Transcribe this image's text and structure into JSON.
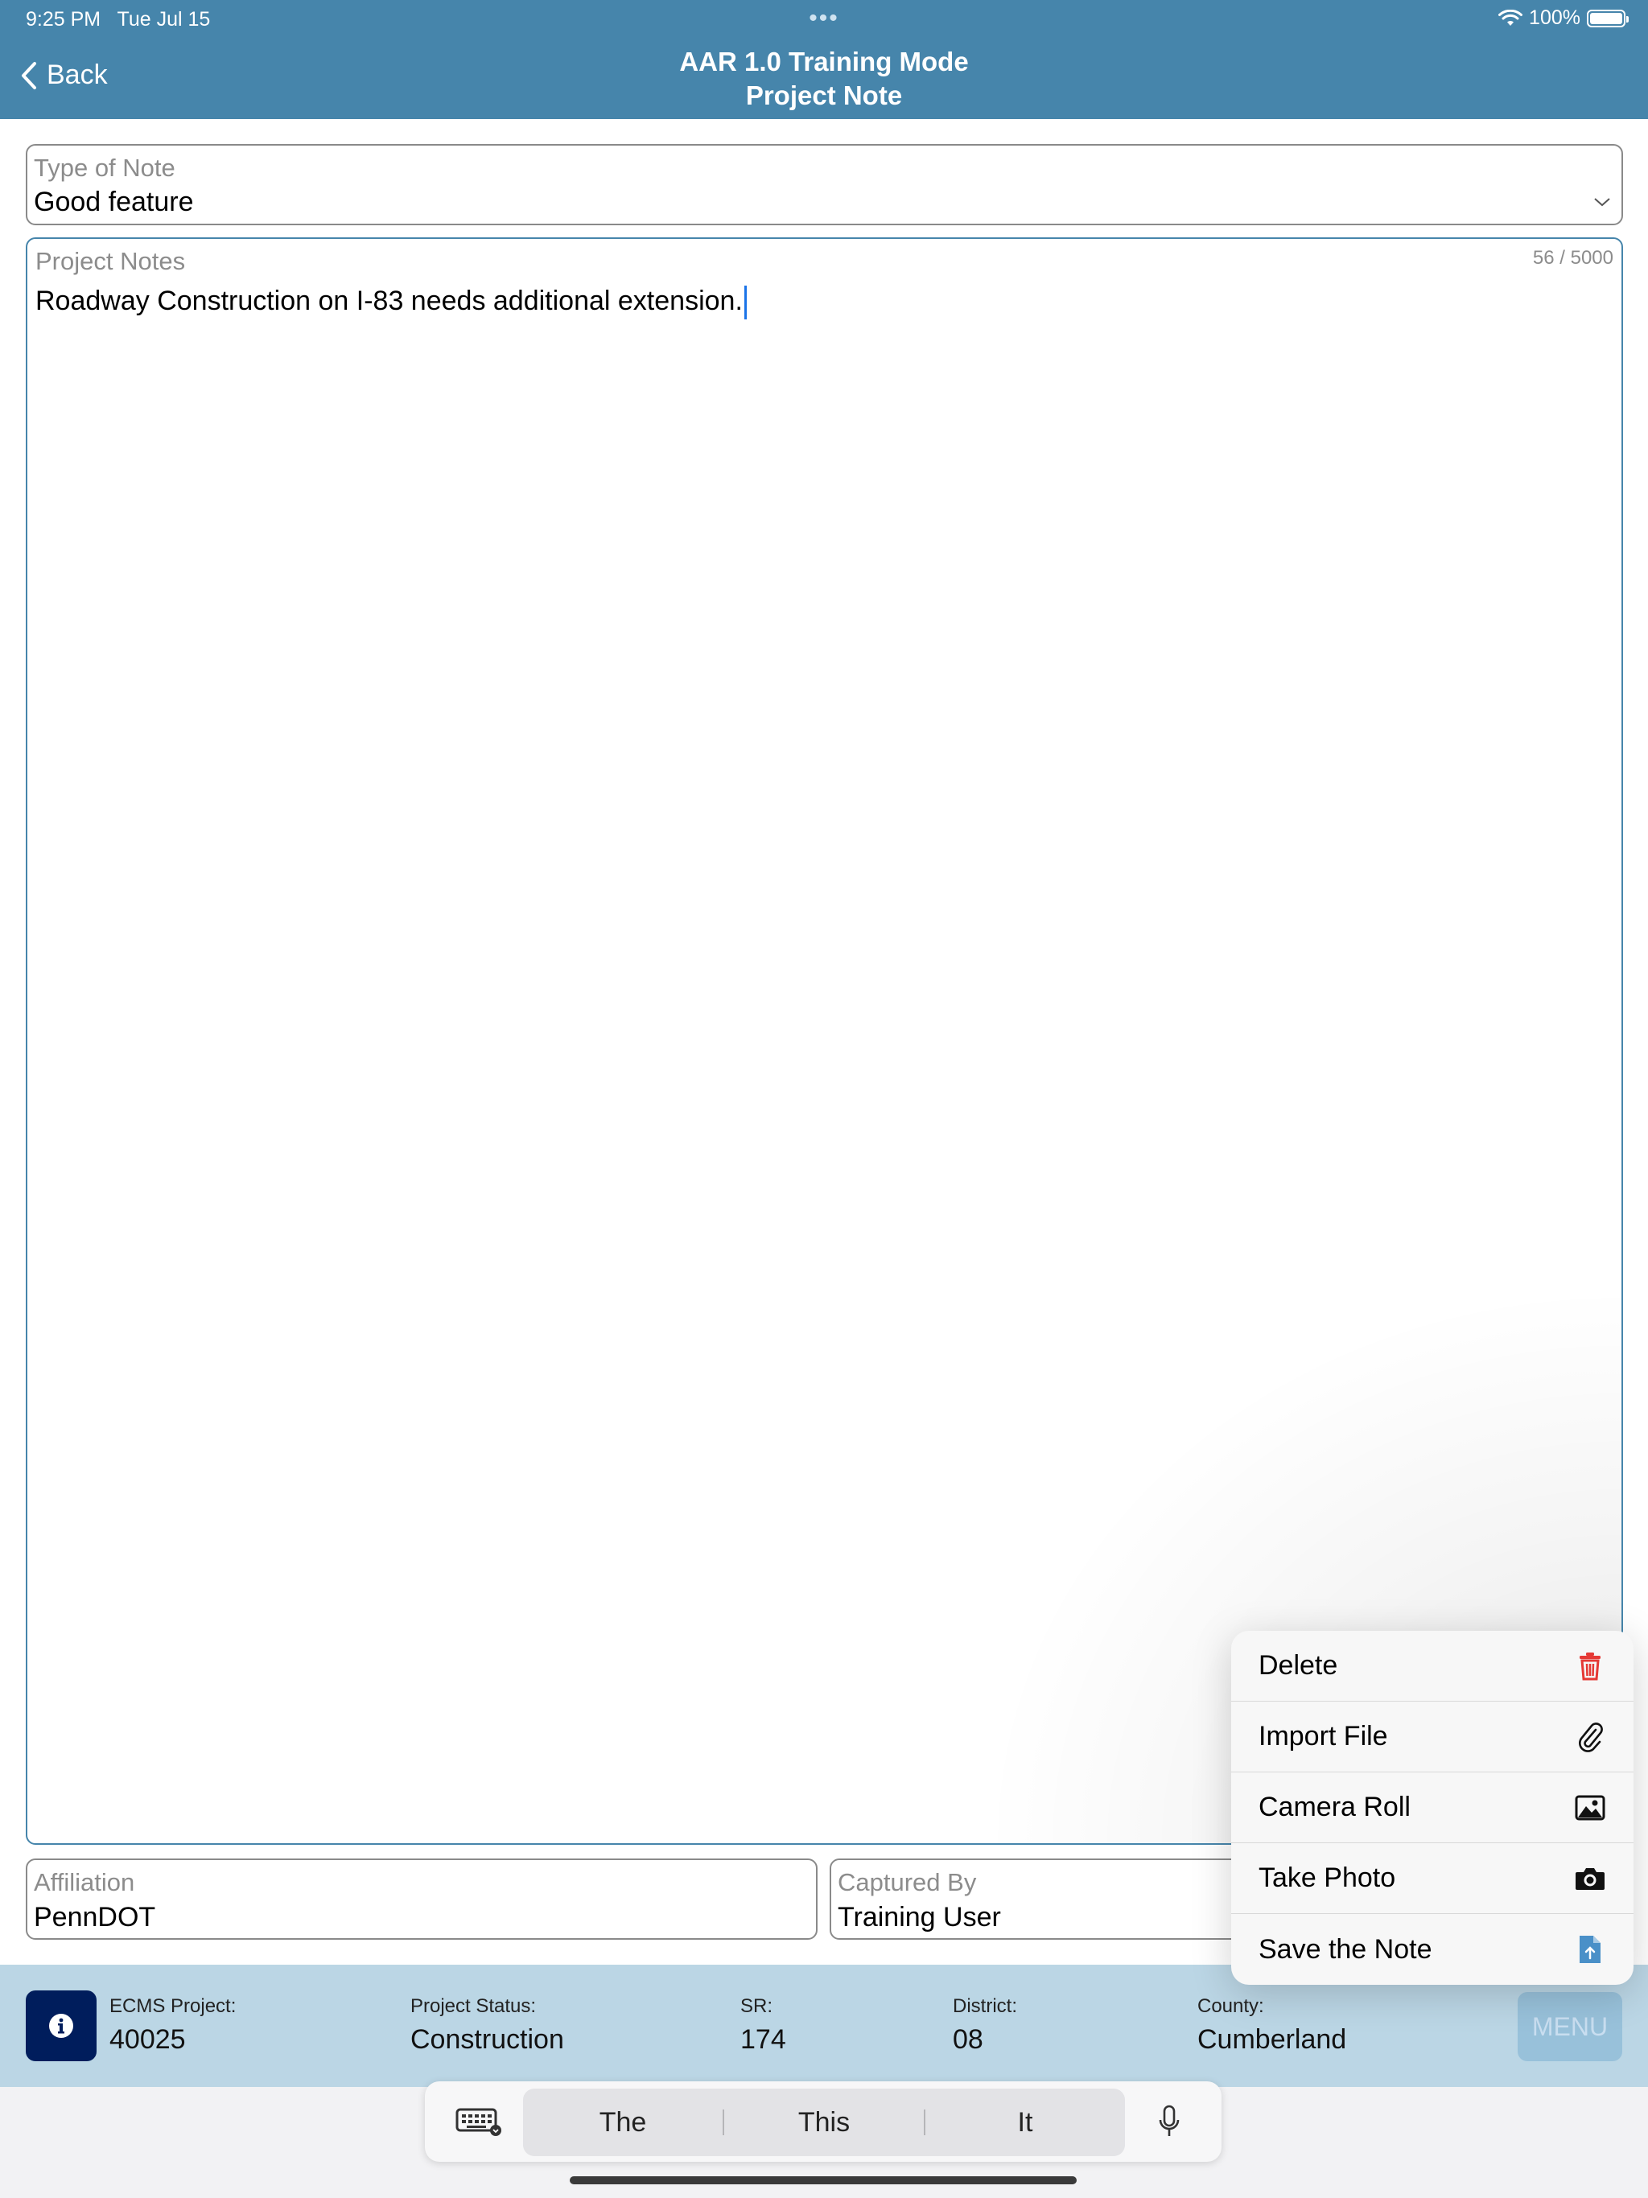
{
  "status_bar": {
    "time": "9:25 PM",
    "date": "Tue Jul 15",
    "battery": "100%"
  },
  "header": {
    "back_label": "Back",
    "title_line1": "AAR 1.0 Training Mode",
    "title_line2": "Project Note",
    "color": "#4685ab"
  },
  "form": {
    "type_of_note": {
      "label": "Type of Note",
      "value": "Good feature"
    },
    "project_notes": {
      "label": "Project Notes",
      "counter": "56 / 5000",
      "value": "Roadway Construction on I-83 needs additional extension."
    },
    "affiliation": {
      "label": "Affiliation",
      "value": "PennDOT"
    },
    "captured_by": {
      "label": "Captured By",
      "value": "Training User"
    }
  },
  "popup_menu": {
    "items": [
      {
        "label": "Delete",
        "icon": "trash-icon",
        "color": "#e53935"
      },
      {
        "label": "Import File",
        "icon": "paperclip-icon",
        "color": "#111111"
      },
      {
        "label": "Camera Roll",
        "icon": "image-icon",
        "color": "#111111"
      },
      {
        "label": "Take Photo",
        "icon": "camera-icon",
        "color": "#111111"
      },
      {
        "label": "Save the Note",
        "icon": "file-upload-icon",
        "color": "#4a90c8"
      }
    ]
  },
  "info_bar": {
    "ecms_label": "ECMS Project:",
    "ecms_value": "40025",
    "status_label": "Project Status:",
    "status_value": "Construction",
    "sr_label": "SR:",
    "sr_value": "174",
    "district_label": "District:",
    "district_value": "08",
    "county_label": "County:",
    "county_value": "Cumberland",
    "menu_label": "MENU"
  },
  "keyboard": {
    "suggestions": [
      "The",
      "This",
      "It"
    ]
  }
}
